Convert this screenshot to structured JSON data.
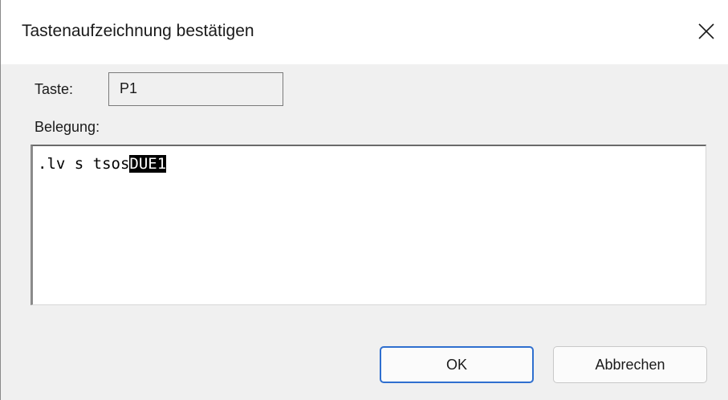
{
  "dialog": {
    "title": "Tastenaufzeichnung bestätigen",
    "close_icon": "close-icon"
  },
  "key": {
    "label": "Taste:",
    "value": "P1"
  },
  "assignment": {
    "label": "Belegung:",
    "text_before_selection": ".lv s tsos",
    "selected_text": "DUE1"
  },
  "buttons": {
    "ok_label": "OK",
    "cancel_label": "Abbrechen"
  },
  "colors": {
    "dialog_background": "#f0f0f0",
    "titlebar_background": "#ffffff",
    "default_button_border": "#2f6fcf",
    "selection_background": "#000000",
    "selection_text": "#ffffff"
  }
}
